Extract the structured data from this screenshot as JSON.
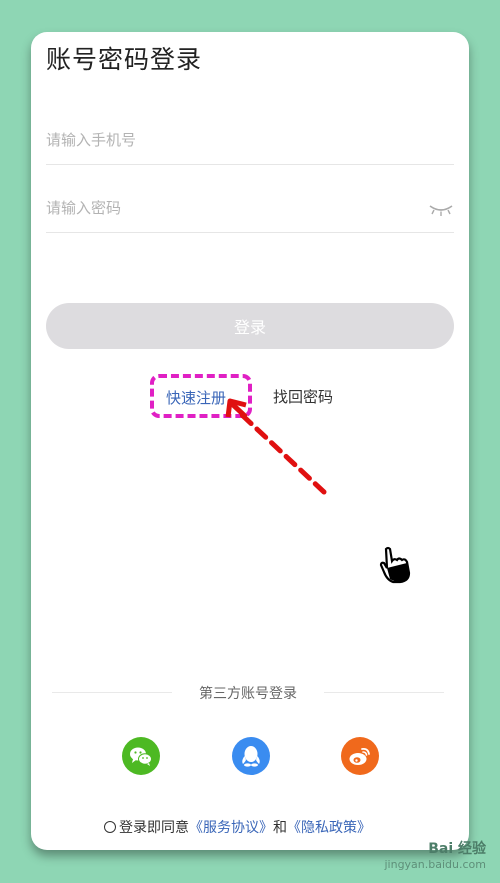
{
  "header": {
    "title": "账号密码登录"
  },
  "form": {
    "phone_placeholder": "请输入手机号",
    "password_placeholder": "请输入密码",
    "login_label": "登录"
  },
  "links": {
    "quick_register": "快速注册",
    "find_password": "找回密码"
  },
  "third_party": {
    "label": "第三方账号登录",
    "providers": [
      {
        "name": "wechat",
        "icon": "wechat-icon",
        "color": "#4db923"
      },
      {
        "name": "qq",
        "icon": "qq-icon",
        "color": "#3a8cf0"
      },
      {
        "name": "weibo",
        "icon": "weibo-icon",
        "color": "#f0691c"
      }
    ]
  },
  "agreement": {
    "prefix": "登录即同意",
    "service": "《服务协议》",
    "and": "和",
    "privacy": "《隐私政策》"
  },
  "watermark": {
    "brand": "Bai 经验",
    "url": "jingyan.baidu.com"
  },
  "colors": {
    "background": "#8ed6b4",
    "highlight_border": "#e020c4",
    "arrow": "#e01010",
    "link": "#3a66b8",
    "button_disabled": "#dddcdf"
  }
}
